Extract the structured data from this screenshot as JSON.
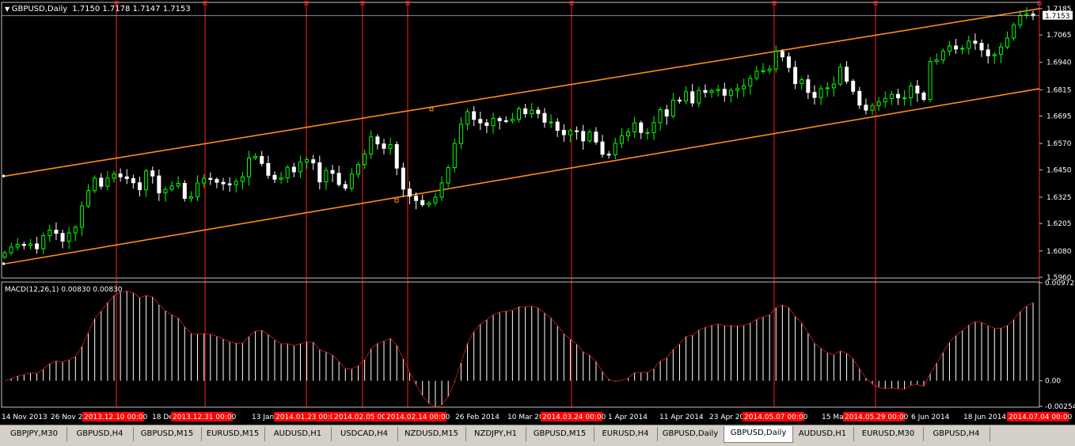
{
  "window": {
    "symbol_header": "GBPUSD,Daily",
    "ohlc": "1.7150 1.7178 1.7147 1.7153"
  },
  "colors": {
    "background": "#000000",
    "bull": "#00ff00",
    "bear": "#ffffff",
    "channel": "#ff8c1a",
    "vline": "#ff2020",
    "macd_line": "#ff2020",
    "histogram": "#ffffff"
  },
  "chart_data": [
    {
      "type": "candlestick",
      "title": "GBPUSD,Daily",
      "ylim": [
        1.596,
        1.721
      ],
      "y_ticks": [
        "1.7185",
        "1.7065",
        "1.6940",
        "1.6815",
        "1.6695",
        "1.6570",
        "1.6450",
        "1.6325",
        "1.6205",
        "1.6080",
        "1.5960"
      ],
      "price_label": "1.7153",
      "x_tick_labels": [
        "14 Nov 2013",
        "26 Nov 2013",
        "18 Dec 2013",
        "13 Jan 2014",
        "26 Feb 2014",
        "10 Mar 2014",
        "1 Apr 2014",
        "11 Apr 2014",
        "23 Apr 2014",
        "15 May 2014",
        "6 Jun 2014",
        "18 Jun 2014"
      ],
      "marked_dates": [
        "2013.12.10 00:00",
        "2013.12.31 00:00",
        "2014.01.23 00:00",
        "2014.02.05 00:00",
        "2014.02.14 00:00",
        "2014.03.24 00:00",
        "2014.05.07 00:00",
        "2014.05.29 00:00",
        "2014.07.04 00:00"
      ],
      "closes": [
        1.6072,
        1.6098,
        1.611,
        1.6105,
        1.6112,
        1.609,
        1.615,
        1.6175,
        1.616,
        1.6125,
        1.6162,
        1.6188,
        1.6285,
        1.6355,
        1.6412,
        1.6375,
        1.6412,
        1.6431,
        1.6418,
        1.641,
        1.6391,
        1.6359,
        1.6445,
        1.6422,
        1.6345,
        1.6361,
        1.6376,
        1.6388,
        1.632,
        1.6327,
        1.639,
        1.6411,
        1.6406,
        1.6393,
        1.6386,
        1.6382,
        1.6397,
        1.6418,
        1.6504,
        1.6511,
        1.6479,
        1.6425,
        1.6407,
        1.6413,
        1.6462,
        1.6441,
        1.6485,
        1.6496,
        1.6482,
        1.6395,
        1.6447,
        1.6434,
        1.6383,
        1.6366,
        1.643,
        1.6474,
        1.6522,
        1.66,
        1.6568,
        1.6548,
        1.6565,
        1.6458,
        1.6362,
        1.633,
        1.631,
        1.6291,
        1.6299,
        1.6325,
        1.639,
        1.646,
        1.657,
        1.6658,
        1.6715,
        1.668,
        1.6664,
        1.6652,
        1.6684,
        1.6674,
        1.6673,
        1.6681,
        1.6728,
        1.6706,
        1.6722,
        1.6707,
        1.6667,
        1.6668,
        1.663,
        1.661,
        1.6628,
        1.6625,
        1.6582,
        1.6622,
        1.6577,
        1.6521,
        1.6519,
        1.6571,
        1.6605,
        1.6623,
        1.6664,
        1.662,
        1.662,
        1.6665,
        1.6724,
        1.6695,
        1.6768,
        1.6764,
        1.6806,
        1.6755,
        1.6812,
        1.6803,
        1.6811,
        1.6817,
        1.679,
        1.6812,
        1.682,
        1.6833,
        1.6867,
        1.69,
        1.6902,
        1.691,
        1.699,
        1.6965,
        1.6917,
        1.6843,
        1.6861,
        1.6803,
        1.678,
        1.682,
        1.6824,
        1.6841,
        1.6918,
        1.6854,
        1.6808,
        1.6745,
        1.6722,
        1.6743,
        1.676,
        1.6775,
        1.6794,
        1.6778,
        1.6778,
        1.6832,
        1.68,
        1.6771,
        1.6944,
        1.6951,
        1.6991,
        1.7015,
        1.7001,
        1.7004,
        1.7037,
        1.7027,
        1.6997,
        1.697,
        1.6976,
        1.701,
        1.7051,
        1.711,
        1.7155,
        1.716,
        1.7153
      ],
      "macd": {
        "label": "MACD(12,26,1) 0.00830 0.00830",
        "ylim": [
          -0.00254,
          0.00972
        ],
        "y_ticks": [
          "0.00972",
          "0.00",
          "-0.00254"
        ]
      }
    }
  ],
  "tabs": [
    "GBPJPY,M30",
    "GBPUSD,H4",
    "GBPUSD,M15",
    "EURUSD,M15",
    "AUDUSD,H1",
    "USDCAD,H4",
    "NZDUSD,M15",
    "NZDJPY,H1",
    "GBPUSD,M15",
    "EURUSD,H4",
    "GBPUSD,Daily",
    "GBPUSD,Daily",
    "AUDUSD,H1",
    "EURUSD,M30",
    "GBPUSD,H4"
  ],
  "active_tab": 11
}
